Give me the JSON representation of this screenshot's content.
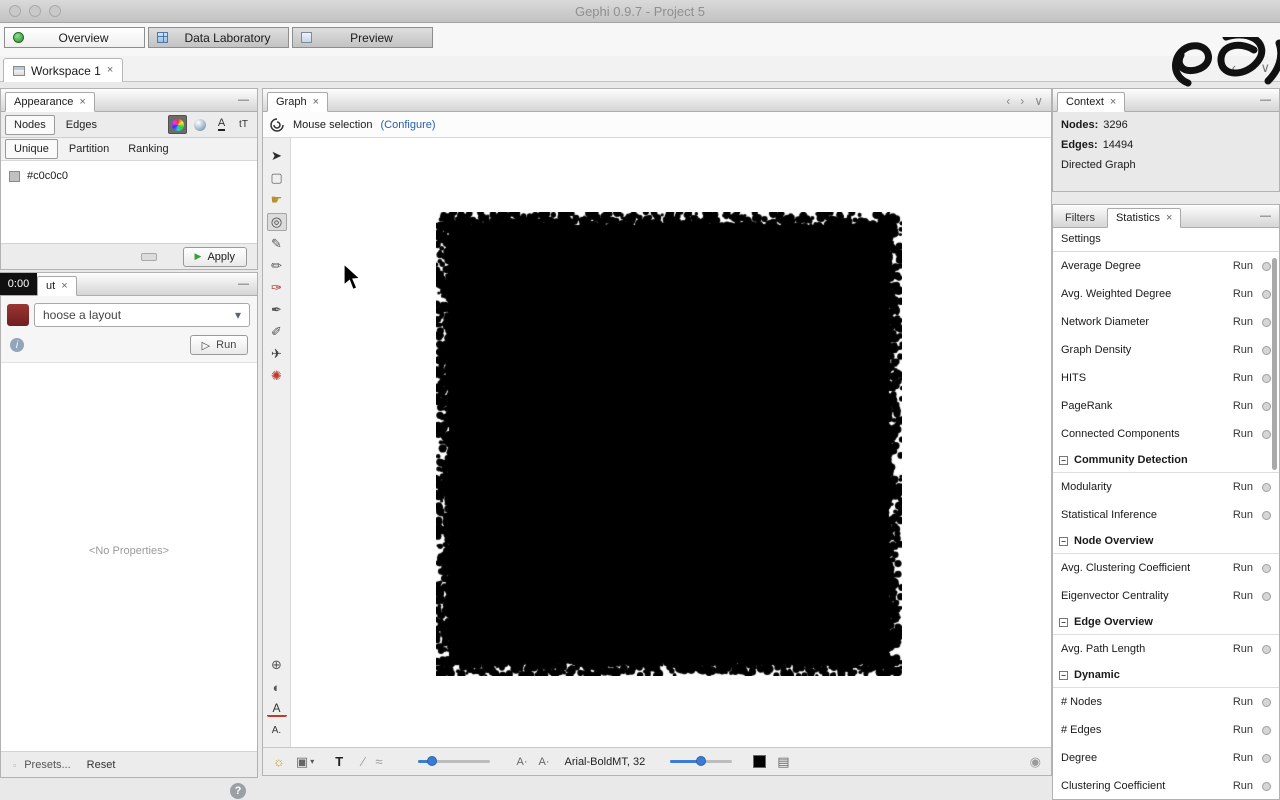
{
  "window": {
    "title": "Gephi 0.9.7 - Project 5"
  },
  "main_tabs": {
    "overview": "Overview",
    "data_laboratory": "Data Laboratory",
    "preview": "Preview"
  },
  "workspace": {
    "label": "Workspace 1"
  },
  "icons": {
    "close": "×",
    "minimize": "—",
    "chevron_left": "‹",
    "chevron_right": "›",
    "chevron_down": "∨",
    "dropdown": "▾",
    "play": "▶",
    "run_play": "▷",
    "info": "i",
    "help": "?",
    "label_color": "A",
    "label_size": "tT",
    "bulb": "☼",
    "screenshot": "▣",
    "labels_t": "T",
    "diagonal": "∕",
    "curve": "≈",
    "a_small": "A·",
    "attributes": "▤",
    "options": "◉"
  },
  "appearance": {
    "title": "Appearance",
    "nodes_tab": "Nodes",
    "edges_tab": "Edges",
    "subtabs": {
      "unique": "Unique",
      "partition": "Partition",
      "ranking": "Ranking"
    },
    "color_value": "#c0c0c0",
    "apply_label": "Apply"
  },
  "layout_panel": {
    "timer": "0:00",
    "tab_label": "ut",
    "dropdown_value": "hoose a layout",
    "run_label": "Run",
    "no_properties": "<No Properties>",
    "presets": "Presets...",
    "reset": "Reset"
  },
  "graph_panel": {
    "tab_label": "Graph",
    "selection_mode": "Mouse selection",
    "configure": "(Configure)",
    "font": "Arial-BoldMT, 32"
  },
  "graph_tools": {
    "top": [
      {
        "name": "direct-selection",
        "glyph": "➤",
        "color": "#2b2b2b"
      },
      {
        "name": "rectangle-selection",
        "glyph": "▢",
        "color": "#666666"
      },
      {
        "name": "drag-hand",
        "glyph": "☛",
        "color": "#b8912f"
      },
      {
        "name": "mouse-selection",
        "glyph": "◎",
        "color": "#444444",
        "pressed": true
      },
      {
        "name": "edge-pencil",
        "glyph": "✎",
        "color": "#555555"
      },
      {
        "name": "node-pencil",
        "glyph": "✏",
        "color": "#555555"
      },
      {
        "name": "painter",
        "glyph": "✑",
        "color": "#a23333"
      },
      {
        "name": "sizer",
        "glyph": "✒",
        "color": "#555555"
      },
      {
        "name": "brush",
        "glyph": "✐",
        "color": "#555555"
      },
      {
        "name": "shortest-path",
        "glyph": "✈",
        "color": "#444444"
      },
      {
        "name": "heat-map",
        "glyph": "✺",
        "color": "#c0392b"
      }
    ],
    "bottom": [
      {
        "name": "zoom",
        "glyph": "⊕",
        "color": "#555555"
      },
      {
        "name": "contrast",
        "glyph": "◐",
        "color": "#555555"
      },
      {
        "name": "label-color",
        "glyph": "A",
        "color": "#333333",
        "underline": true
      },
      {
        "name": "label-size",
        "glyph": "A.",
        "color": "#333333",
        "small": true
      }
    ]
  },
  "context": {
    "title": "Context",
    "nodes_label": "Nodes:",
    "nodes_value": "3296",
    "edges_label": "Edges:",
    "edges_value": "14494",
    "graph_type": "Directed Graph"
  },
  "stats": {
    "filters_tab": "Filters",
    "statistics_tab": "Statistics",
    "settings": "Settings",
    "run": "Run",
    "items": [
      {
        "label": "Average Degree"
      },
      {
        "label": "Avg. Weighted Degree"
      },
      {
        "label": "Network Diameter"
      },
      {
        "label": "Graph Density"
      },
      {
        "label": "HITS"
      },
      {
        "label": "PageRank"
      },
      {
        "label": "Connected Components"
      },
      {
        "label": "Community Detection",
        "section": true
      },
      {
        "label": "Modularity"
      },
      {
        "label": "Statistical Inference"
      },
      {
        "label": "Node Overview",
        "section": true
      },
      {
        "label": "Avg. Clustering Coefficient"
      },
      {
        "label": "Eigenvector Centrality"
      },
      {
        "label": "Edge Overview",
        "section": true
      },
      {
        "label": "Avg. Path Length"
      },
      {
        "label": "Dynamic",
        "section": true
      },
      {
        "label": "# Nodes"
      },
      {
        "label": "# Edges"
      },
      {
        "label": "Degree"
      },
      {
        "label": "Clustering Coefficient"
      }
    ]
  }
}
